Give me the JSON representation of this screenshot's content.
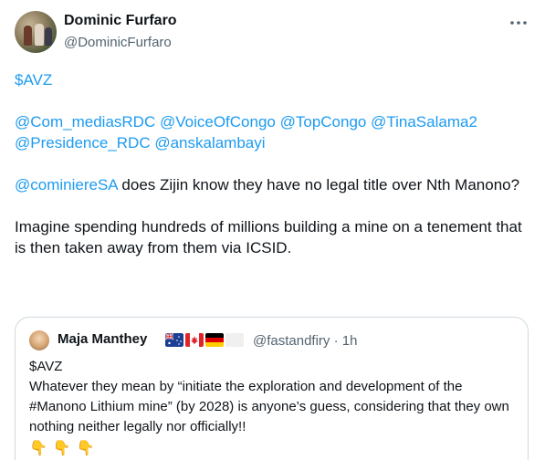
{
  "author": {
    "display_name": "Dominic Furfaro",
    "handle": "@DominicFurfaro"
  },
  "tweet": {
    "cashtag": "$AVZ",
    "mentions_line1": [
      "@Com_mediasRDC",
      "@VoiceOfCongo",
      "@TopCongo",
      "@TinaSalama2"
    ],
    "mentions_line2": [
      "@Presidence_RDC",
      "@anskalambayi"
    ],
    "reply_mention": "@cominiereSA",
    "reply_text": " does Zijin know they have no legal title over Nth Manono?",
    "paragraph": "Imagine spending hundreds of millions building a mine on a tenement that is then taken away from them via ICSID."
  },
  "quote": {
    "display_name": "Maja Manthey",
    "handle_time": "@fastandfiry · 1h",
    "flags": [
      "australia-flag",
      "canada-flag",
      "germany-flag",
      "white-flag"
    ],
    "line1": "$AVZ",
    "body": "Whatever they mean by “initiate the exploration and development of the #Manono Lithium mine” (by 2028) is anyone’s guess, considering that they own nothing neither legally nor officially!!",
    "emojis": [
      "👇",
      "👇",
      "👇"
    ]
  }
}
